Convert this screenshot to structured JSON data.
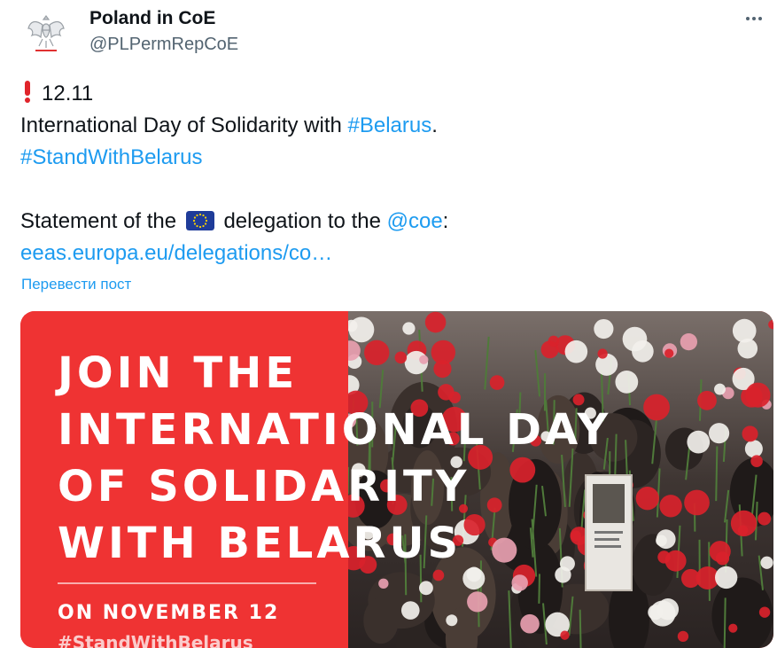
{
  "author": {
    "display_name": "Poland in CoE",
    "handle": "@PLPermRepCoE",
    "avatar": "polish-eagle-emblem"
  },
  "menu": {
    "icon": "more-horizontal-icon"
  },
  "tweet": {
    "date_text": "12.11",
    "line2_prefix": "International Day of Solidarity with ",
    "line2_hashtag": "#Belarus",
    "line2_suffix": ".",
    "hashtag_line": "#StandWithBelarus",
    "statement_prefix": "Statement of the",
    "statement_middle": "delegation to the",
    "statement_mention": "@coe",
    "statement_suffix": ":",
    "url": "eeas.europa.eu/delegations/co…"
  },
  "translate_link": "Перевести пост",
  "media": {
    "headline": [
      "JOIN THE",
      "INTERNATIONAL DAY",
      "OF SOLIDARITY",
      "WITH BELARUS"
    ],
    "date": "ON NOVEMBER 12",
    "hashtag": "#StandWithBelarus"
  },
  "colors": {
    "link": "#1d9bf0",
    "text": "#0f1419",
    "muted": "#536471",
    "banner_red": "#ef3333",
    "flower_red": "#d9222b"
  }
}
